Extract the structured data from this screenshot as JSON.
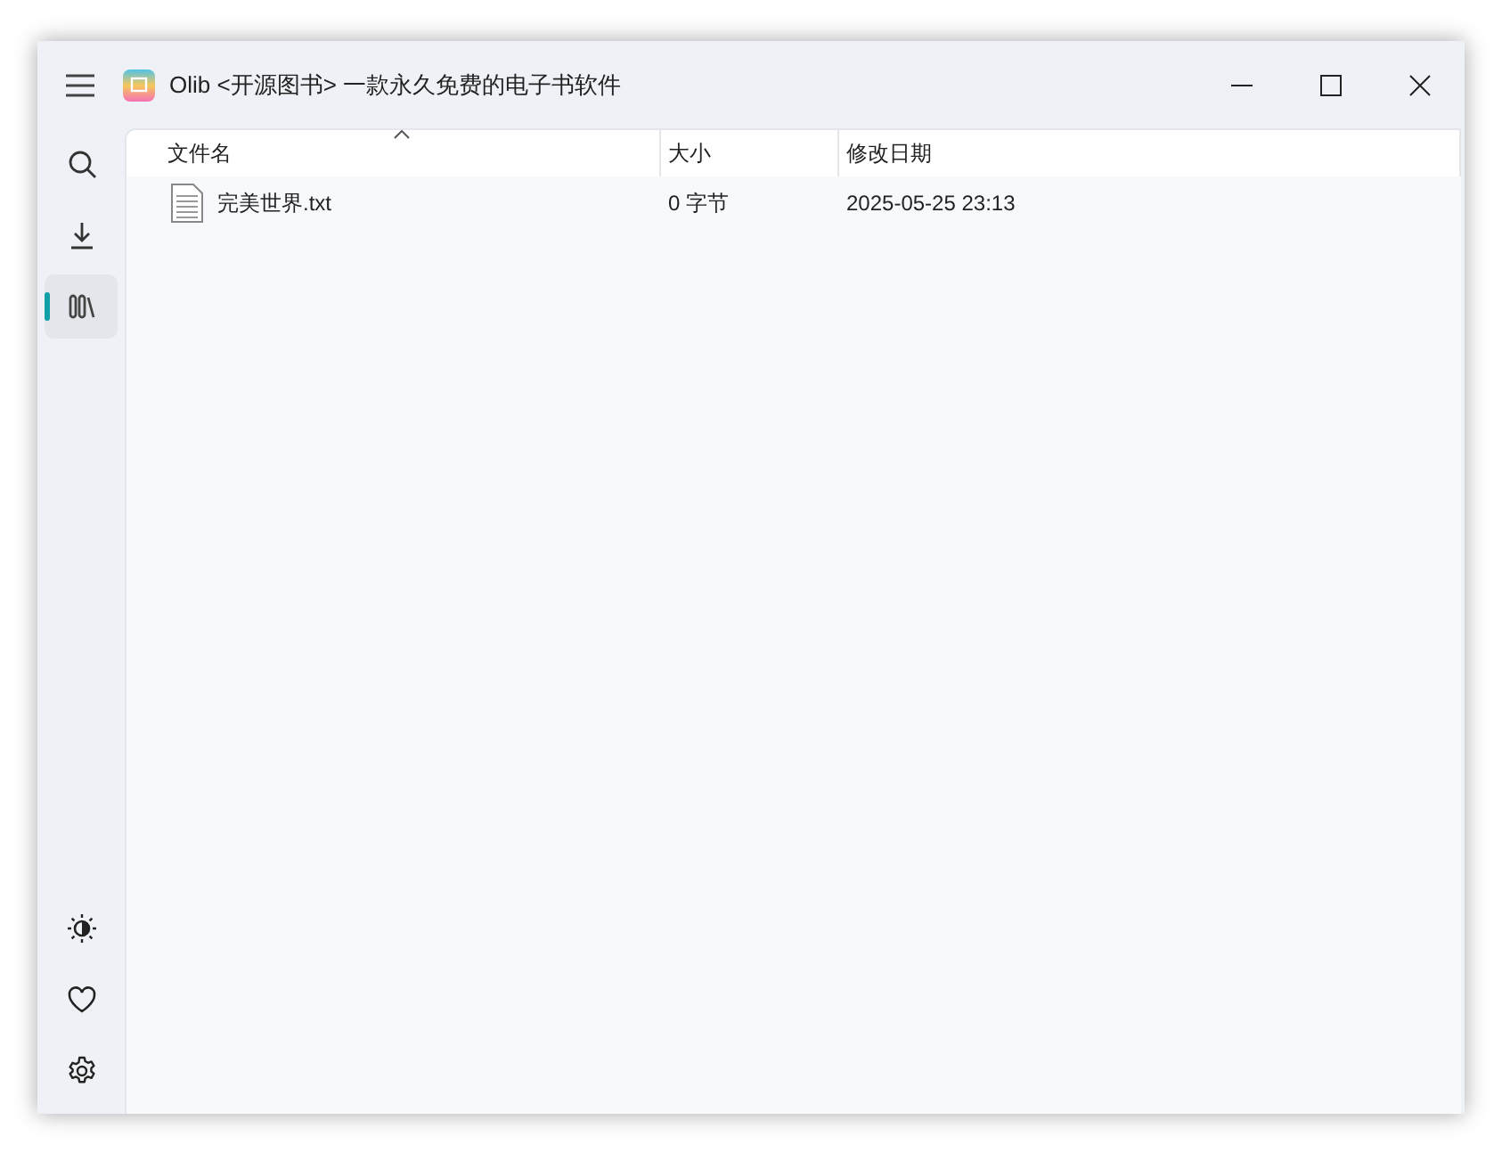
{
  "window": {
    "title": "Olib <开源图书> 一款永久免费的电子书软件"
  },
  "nav": {
    "top": [
      {
        "kind": "search",
        "selected": false
      },
      {
        "kind": "download",
        "selected": false
      },
      {
        "kind": "library",
        "selected": true
      }
    ],
    "bottom": [
      {
        "kind": "theme",
        "selected": false
      },
      {
        "kind": "favorite",
        "selected": false
      },
      {
        "kind": "settings",
        "selected": false
      }
    ]
  },
  "table": {
    "columns": [
      {
        "label": "文件名",
        "sorted": true
      },
      {
        "label": "大小",
        "sorted": false
      },
      {
        "label": "修改日期",
        "sorted": false
      }
    ],
    "rows": [
      {
        "name": "完美世界.txt",
        "size": "0 字节",
        "modified": "2025-05-25 23:13"
      }
    ]
  }
}
